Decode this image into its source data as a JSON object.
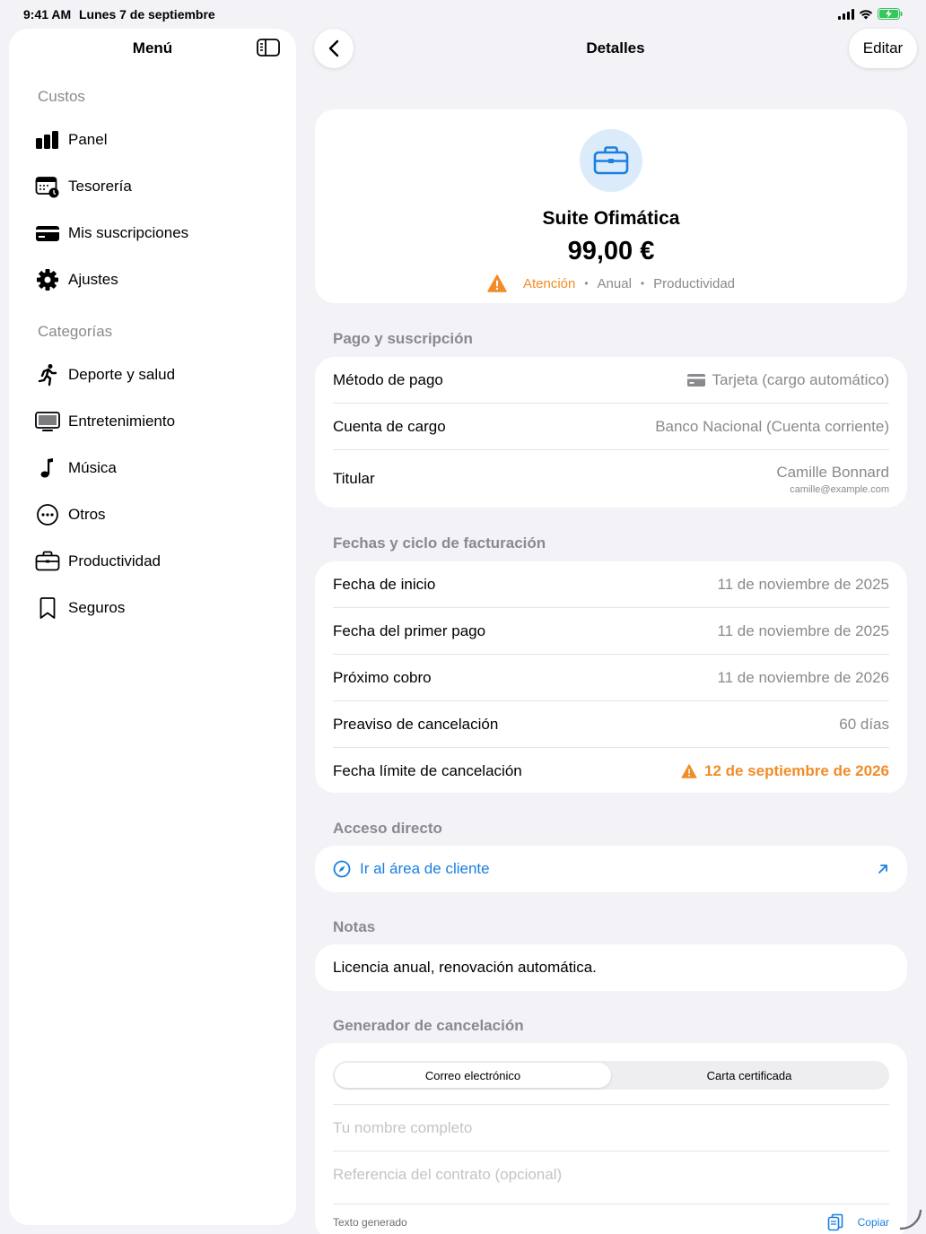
{
  "status": {
    "time": "9:41 AM",
    "date": "Lunes 7 de septiembre"
  },
  "sidebar": {
    "title": "Menú",
    "section_costs": "Custos",
    "costs_items": [
      {
        "label": "Panel",
        "icon": "chart-bar-icon"
      },
      {
        "label": "Tesorería",
        "icon": "calendar-clock-icon"
      },
      {
        "label": "Mis suscripciones",
        "icon": "credit-card-icon"
      },
      {
        "label": "Ajustes",
        "icon": "gear-icon"
      }
    ],
    "section_categories": "Categorías",
    "category_items": [
      {
        "label": "Deporte y salud",
        "icon": "running-figure-icon"
      },
      {
        "label": "Entretenimiento",
        "icon": "tv-icon"
      },
      {
        "label": "Música",
        "icon": "music-note-icon"
      },
      {
        "label": "Otros",
        "icon": "ellipsis-circle-icon"
      },
      {
        "label": "Productividad",
        "icon": "briefcase-icon"
      },
      {
        "label": "Seguros",
        "icon": "bookmark-icon"
      }
    ]
  },
  "header": {
    "title": "Detalles",
    "edit_label": "Editar"
  },
  "hero": {
    "name": "Suite Ofimática",
    "price": "99,00 €",
    "status": "Atención",
    "cycle": "Anual",
    "category": "Productividad",
    "accent": "#1a7fe0",
    "warning_color": "#f28c28"
  },
  "payment": {
    "title": "Pago y suscripción",
    "method_label": "Método de pago",
    "method_value": "Tarjeta (cargo automático)",
    "account_label": "Cuenta de cargo",
    "account_value": "Banco Nacional (Cuenta corriente)",
    "holder_label": "Titular",
    "holder_name": "Camille Bonnard",
    "holder_email": "camille@example.com"
  },
  "dates": {
    "title": "Fechas y ciclo de facturación",
    "rows": [
      {
        "label": "Fecha de inicio",
        "value": "11 de noviembre de 2025"
      },
      {
        "label": "Fecha del primer pago",
        "value": "11 de noviembre de 2025"
      },
      {
        "label": "Próximo cobro",
        "value": "11 de noviembre de 2026"
      },
      {
        "label": "Preaviso de cancelación",
        "value": "60 días"
      },
      {
        "label": "Fecha límite de cancelación",
        "value": "12 de septiembre de 2026"
      }
    ]
  },
  "shortcut": {
    "title": "Acceso directo",
    "link": "Ir al área de cliente"
  },
  "notes": {
    "title": "Notas",
    "text": "Licencia anual, renovación automática."
  },
  "generator": {
    "title": "Generador de cancelación",
    "tabs": [
      "Correo electrónico",
      "Carta certificada"
    ],
    "name_placeholder": "Tu nombre completo",
    "ref_placeholder": "Referencia del contrato (opcional)",
    "generated_label": "Texto generado",
    "copy_label": "Copiar"
  }
}
